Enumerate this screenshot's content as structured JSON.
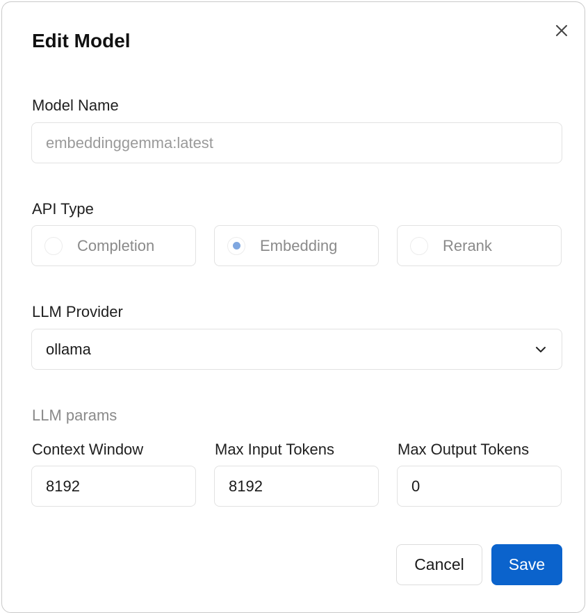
{
  "dialog": {
    "title": "Edit Model"
  },
  "model_name": {
    "label": "Model Name",
    "value": "embeddinggemma:latest"
  },
  "api_type": {
    "label": "API Type",
    "options": [
      {
        "label": "Completion",
        "selected": false
      },
      {
        "label": "Embedding",
        "selected": true
      },
      {
        "label": "Rerank",
        "selected": false
      }
    ]
  },
  "llm_provider": {
    "label": "LLM Provider",
    "value": "ollama"
  },
  "llm_params": {
    "section_label": "LLM params",
    "context_window": {
      "label": "Context Window",
      "value": "8192"
    },
    "max_input_tokens": {
      "label": "Max Input Tokens",
      "value": "8192"
    },
    "max_output_tokens": {
      "label": "Max Output Tokens",
      "value": "0"
    }
  },
  "actions": {
    "cancel_label": "Cancel",
    "save_label": "Save"
  },
  "colors": {
    "primary": "#0b63cc",
    "radio_selected": "#7fa7e0"
  }
}
